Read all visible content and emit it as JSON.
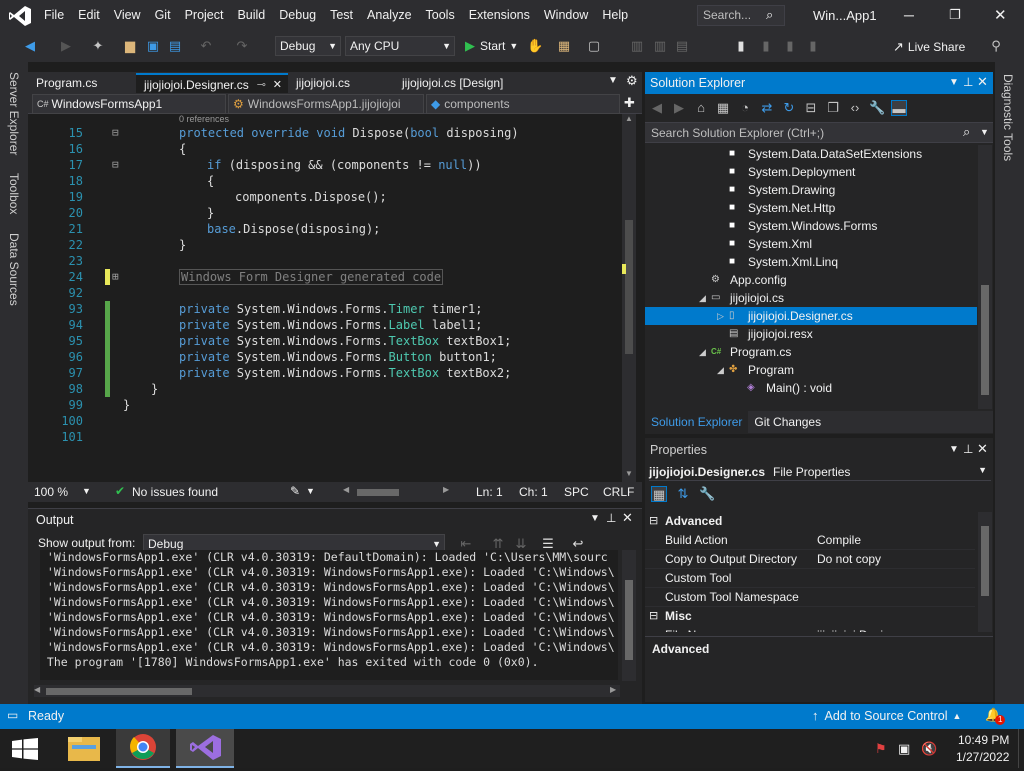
{
  "menu": {
    "logo": "visual-studio-logo",
    "items": [
      "File",
      "Edit",
      "View",
      "Git",
      "Project",
      "Build",
      "Debug",
      "Test",
      "Analyze",
      "Tools",
      "Extensions",
      "Window",
      "Help"
    ],
    "search_placeholder": "Search...",
    "window_title": "Win...App1"
  },
  "toolbar": {
    "config": "Debug",
    "platform": "Any CPU",
    "start_label": "Start",
    "live_share": "Live Share"
  },
  "side_tabs": [
    "Server Explorer",
    "Toolbox",
    "Data Sources"
  ],
  "right_side_tab": "Diagnostic Tools",
  "editor": {
    "tabs": [
      {
        "label": "Program.cs",
        "active": false
      },
      {
        "label": "jijojiojoi.Designer.cs",
        "active": true
      },
      {
        "label": "jijojiojoi.cs",
        "active": false
      },
      {
        "label": "jijojiojoi.cs [Design]",
        "active": false
      }
    ],
    "nav": {
      "project": "WindowsFormsApp1",
      "class": "WindowsFormsApp1.jijojiojoi",
      "member": "components"
    },
    "codelens": "0 references",
    "lines": [
      {
        "n": "15",
        "tokens": [
          {
            "t": "protected ",
            "c": "kw"
          },
          {
            "t": "override ",
            "c": "kw"
          },
          {
            "t": "void ",
            "c": "kw"
          },
          {
            "t": "Dispose(",
            "c": "tx"
          },
          {
            "t": "bool ",
            "c": "kw"
          },
          {
            "t": "disposing)",
            "c": "tx"
          }
        ],
        "indent": 0
      },
      {
        "n": "16",
        "tokens": [
          {
            "t": "{",
            "c": "tx"
          }
        ],
        "indent": 0
      },
      {
        "n": "17",
        "tokens": [
          {
            "t": "if ",
            "c": "kw"
          },
          {
            "t": "(disposing && (components != ",
            "c": "tx"
          },
          {
            "t": "null",
            "c": "kw"
          },
          {
            "t": "))",
            "c": "tx"
          }
        ],
        "indent": 1
      },
      {
        "n": "18",
        "tokens": [
          {
            "t": "{",
            "c": "tx"
          }
        ],
        "indent": 1
      },
      {
        "n": "19",
        "tokens": [
          {
            "t": "components.Dispose();",
            "c": "tx"
          }
        ],
        "indent": 2
      },
      {
        "n": "20",
        "tokens": [
          {
            "t": "}",
            "c": "tx"
          }
        ],
        "indent": 1
      },
      {
        "n": "21",
        "tokens": [
          {
            "t": "base",
            "c": "kw"
          },
          {
            "t": ".Dispose(disposing);",
            "c": "tx"
          }
        ],
        "indent": 1
      },
      {
        "n": "22",
        "tokens": [
          {
            "t": "}",
            "c": "tx"
          }
        ],
        "indent": 0
      },
      {
        "n": "23",
        "tokens": [],
        "indent": 0
      },
      {
        "n": "24",
        "tokens": [
          {
            "t": "Windows Form Designer generated code",
            "c": "gr"
          }
        ],
        "indent": 0,
        "region": true
      },
      {
        "n": "92",
        "tokens": [],
        "indent": 0
      },
      {
        "n": "93",
        "tokens": [
          {
            "t": "private ",
            "c": "kw"
          },
          {
            "t": "System.Windows.Forms.",
            "c": "tx"
          },
          {
            "t": "Timer ",
            "c": "ty"
          },
          {
            "t": "timer1;",
            "c": "tx"
          }
        ],
        "indent": 0
      },
      {
        "n": "94",
        "tokens": [
          {
            "t": "private ",
            "c": "kw"
          },
          {
            "t": "System.Windows.Forms.",
            "c": "tx"
          },
          {
            "t": "Label ",
            "c": "ty"
          },
          {
            "t": "label1;",
            "c": "tx"
          }
        ],
        "indent": 0
      },
      {
        "n": "95",
        "tokens": [
          {
            "t": "private ",
            "c": "kw"
          },
          {
            "t": "System.Windows.Forms.",
            "c": "tx"
          },
          {
            "t": "TextBox ",
            "c": "ty"
          },
          {
            "t": "textBox1;",
            "c": "tx"
          }
        ],
        "indent": 0
      },
      {
        "n": "96",
        "tokens": [
          {
            "t": "private ",
            "c": "kw"
          },
          {
            "t": "System.Windows.Forms.",
            "c": "tx"
          },
          {
            "t": "Button ",
            "c": "ty"
          },
          {
            "t": "button1;",
            "c": "tx"
          }
        ],
        "indent": 0
      },
      {
        "n": "97",
        "tokens": [
          {
            "t": "private ",
            "c": "kw"
          },
          {
            "t": "System.Windows.Forms.",
            "c": "tx"
          },
          {
            "t": "TextBox ",
            "c": "ty"
          },
          {
            "t": "textBox2;",
            "c": "tx"
          }
        ],
        "indent": 0
      },
      {
        "n": "98",
        "tokens": [
          {
            "t": "}",
            "c": "tx"
          }
        ],
        "indent": -1
      },
      {
        "n": "99",
        "tokens": [
          {
            "t": "}",
            "c": "tx"
          }
        ],
        "indent": -2
      },
      {
        "n": "100",
        "tokens": [],
        "indent": 0
      },
      {
        "n": "101",
        "tokens": [],
        "indent": 0
      }
    ],
    "status": {
      "zoom": "100 %",
      "issues": "No issues found",
      "ln": "Ln: 1",
      "ch": "Ch: 1",
      "spc": "SPC",
      "crlf": "CRLF"
    }
  },
  "output": {
    "title": "Output",
    "show_from_label": "Show output from:",
    "source": "Debug",
    "lines": [
      " 'WindowsFormsApp1.exe' (CLR v4.0.30319: DefaultDomain): Loaded 'C:\\Users\\MM\\sourc",
      " 'WindowsFormsApp1.exe' (CLR v4.0.30319: WindowsFormsApp1.exe): Loaded 'C:\\Windows\\",
      " 'WindowsFormsApp1.exe' (CLR v4.0.30319: WindowsFormsApp1.exe): Loaded 'C:\\Windows\\",
      " 'WindowsFormsApp1.exe' (CLR v4.0.30319: WindowsFormsApp1.exe): Loaded 'C:\\Windows\\",
      " 'WindowsFormsApp1.exe' (CLR v4.0.30319: WindowsFormsApp1.exe): Loaded 'C:\\Windows\\",
      " 'WindowsFormsApp1.exe' (CLR v4.0.30319: WindowsFormsApp1.exe): Loaded 'C:\\Windows\\",
      " 'WindowsFormsApp1.exe' (CLR v4.0.30319: WindowsFormsApp1.exe): Loaded 'C:\\Windows\\",
      " The program '[1780] WindowsFormsApp1.exe' has exited with code 0 (0x0)."
    ]
  },
  "solution_explorer": {
    "title": "Solution Explorer",
    "search_placeholder": "Search Solution Explorer (Ctrl+;)",
    "items": [
      {
        "label": "System.Data.DataSetExtensions",
        "icon": "reference-icon",
        "level": 4,
        "arrow": ""
      },
      {
        "label": "System.Deployment",
        "icon": "reference-icon",
        "level": 4,
        "arrow": ""
      },
      {
        "label": "System.Drawing",
        "icon": "reference-icon",
        "level": 4,
        "arrow": ""
      },
      {
        "label": "System.Net.Http",
        "icon": "reference-icon",
        "level": 4,
        "arrow": ""
      },
      {
        "label": "System.Windows.Forms",
        "icon": "reference-icon",
        "level": 4,
        "arrow": ""
      },
      {
        "label": "System.Xml",
        "icon": "reference-icon",
        "level": 4,
        "arrow": ""
      },
      {
        "label": "System.Xml.Linq",
        "icon": "reference-icon",
        "level": 4,
        "arrow": ""
      },
      {
        "label": "App.config",
        "icon": "config-file-icon",
        "level": 3,
        "arrow": ""
      },
      {
        "label": "jijojiojoi.cs",
        "icon": "form-icon",
        "level": 3,
        "arrow": "◢"
      },
      {
        "label": "jijojiojoi.Designer.cs",
        "icon": "cs-file-icon",
        "level": 4,
        "arrow": "▷",
        "selected": true
      },
      {
        "label": "jijojiojoi.resx",
        "icon": "resx-file-icon",
        "level": 4,
        "arrow": ""
      },
      {
        "label": "Program.cs",
        "icon": "csharp-icon",
        "level": 3,
        "arrow": "◢",
        "prefix": "C#"
      },
      {
        "label": "Program",
        "icon": "class-icon",
        "level": 4,
        "arrow": "◢"
      },
      {
        "label": "Main() : void",
        "icon": "method-icon",
        "level": 5,
        "arrow": ""
      }
    ],
    "bottom_tabs": [
      "Solution Explorer",
      "Git Changes"
    ]
  },
  "properties": {
    "title": "Properties",
    "object": "jijojiojoi.Designer.cs",
    "object_type": "File Properties",
    "groups": [
      {
        "name": "Advanced",
        "rows": [
          {
            "k": "Build Action",
            "v": "Compile"
          },
          {
            "k": "Copy to Output Directory",
            "v": "Do not copy"
          },
          {
            "k": "Custom Tool",
            "v": ""
          },
          {
            "k": "Custom Tool Namespace",
            "v": ""
          }
        ]
      },
      {
        "name": "Misc",
        "rows": [
          {
            "k": "File Name",
            "v": "jijojiojoi.Designer.cs"
          }
        ]
      }
    ],
    "description_title": "Advanced"
  },
  "statusbar": {
    "ready": "Ready",
    "source_control": "Add to Source Control",
    "notifications": "1"
  },
  "taskbar": {
    "time": "10:49 PM",
    "date": "1/27/2022"
  }
}
